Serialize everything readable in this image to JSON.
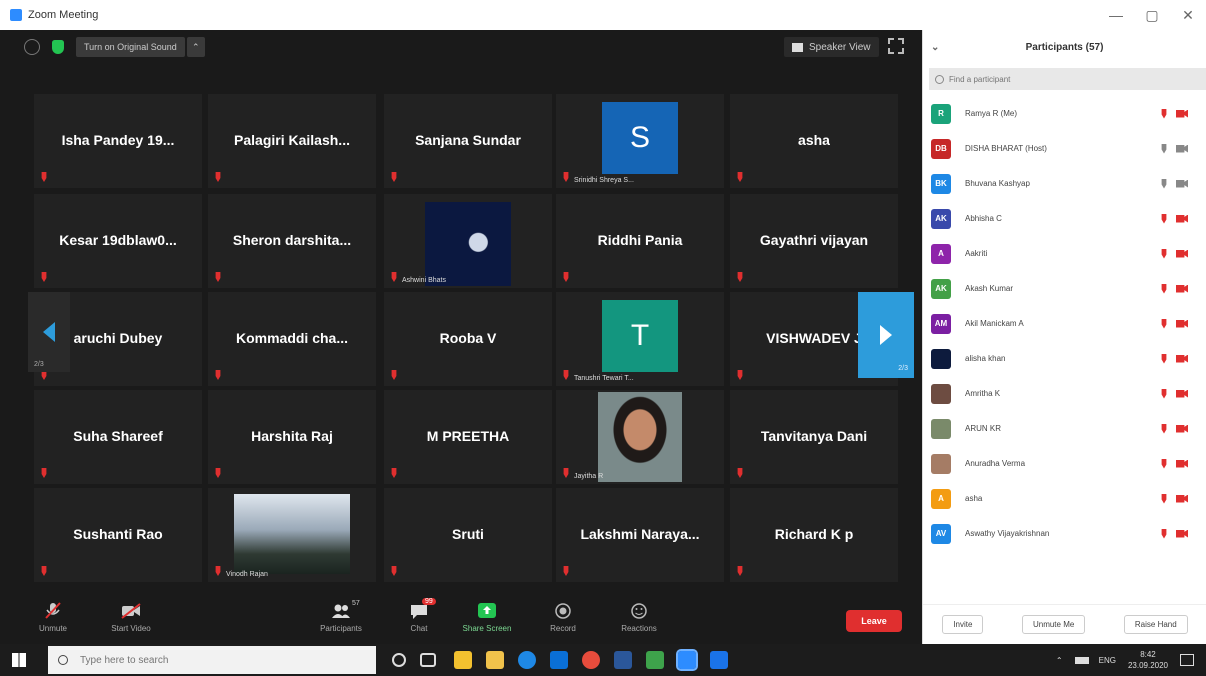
{
  "window": {
    "title": "Zoom Meeting",
    "controls": [
      "—",
      "▢",
      "✕"
    ]
  },
  "topbar": {
    "original_sound": "Turn on Original Sound",
    "caret": "⌃",
    "speaker_view": "Speaker View"
  },
  "pager": {
    "left_page": "2/3",
    "right_page": "2/3"
  },
  "tiles": [
    {
      "name": "Isha Pandey 19..."
    },
    {
      "name": "Palagiri Kailash..."
    },
    {
      "name": "Sanjana Sundar"
    },
    {
      "name": "",
      "avatar_letter": "S",
      "avatar_color": "#1565b5",
      "caption": "Srinidhi Shreya S..."
    },
    {
      "name": "asha"
    },
    {
      "name": "Kesar 19dblaw0..."
    },
    {
      "name": "Sheron darshita..."
    },
    {
      "name": "",
      "image": "moon",
      "caption": "Ashwini Bhats"
    },
    {
      "name": "Riddhi Pania"
    },
    {
      "name": "Gayathri vijayan"
    },
    {
      "name": "aruchi Dubey"
    },
    {
      "name": "Kommaddi cha..."
    },
    {
      "name": "Rooba V"
    },
    {
      "name": "",
      "avatar_letter": "T",
      "avatar_color": "#13967f",
      "caption": "Tanushri Tewari T..."
    },
    {
      "name": "VISHWADEV J"
    },
    {
      "name": "Suha Shareef"
    },
    {
      "name": "Harshita Raj"
    },
    {
      "name": "M PREETHA"
    },
    {
      "name": "",
      "image": "portrait",
      "caption": "Jayitha R"
    },
    {
      "name": "Tanvitanya Dani"
    },
    {
      "name": "Sushanti Rao"
    },
    {
      "name": "",
      "image": "landscape",
      "caption": "Vinodh Rajan"
    },
    {
      "name": "Sruti"
    },
    {
      "name": "Lakshmi Naraya..."
    },
    {
      "name": "Richard K p"
    }
  ],
  "toolbar": {
    "unmute": "Unmute",
    "start_video": "Start Video",
    "participants": "Participants",
    "participants_count": "57",
    "chat": "Chat",
    "chat_badge": "99",
    "share_screen": "Share Screen",
    "record": "Record",
    "reactions": "Reactions",
    "leave": "Leave"
  },
  "panel": {
    "title": "Participants (57)",
    "search_placeholder": "Find a participant",
    "participants": [
      {
        "name": "Ramya R (Me)",
        "initials": "R",
        "color": "#1aa37a",
        "mic": "muted",
        "cam": "off"
      },
      {
        "name": "DISHA BHARAT (Host)",
        "initials": "DB",
        "color": "#c62828",
        "mic": "on",
        "cam": "on"
      },
      {
        "name": "Bhuvana Kashyap",
        "initials": "BK",
        "color": "#1e88e5",
        "mic": "on",
        "cam": "on"
      },
      {
        "name": "Abhisha C",
        "initials": "AK",
        "color": "#3949ab",
        "mic": "muted",
        "cam": "off"
      },
      {
        "name": "Aakriti",
        "initials": "A",
        "color": "#8e24aa",
        "mic": "muted",
        "cam": "off"
      },
      {
        "name": "Akash Kumar",
        "initials": "AK",
        "color": "#43a047",
        "mic": "muted",
        "cam": "off"
      },
      {
        "name": "Akil Manickam A",
        "initials": "AM",
        "color": "#7b1fa2",
        "mic": "muted",
        "cam": "off"
      },
      {
        "name": "alisha khan",
        "initials": "",
        "color": "#0d1b3d",
        "mic": "muted",
        "cam": "off"
      },
      {
        "name": "Amritha K",
        "initials": "",
        "color": "#6d4c41",
        "mic": "muted",
        "cam": "off"
      },
      {
        "name": "ARUN KR",
        "initials": "",
        "color": "#7a8a6a",
        "mic": "muted",
        "cam": "off"
      },
      {
        "name": "Anuradha Verma",
        "initials": "",
        "color": "#a57c65",
        "mic": "muted",
        "cam": "off"
      },
      {
        "name": "asha",
        "initials": "A",
        "color": "#f39c12",
        "mic": "muted",
        "cam": "off"
      },
      {
        "name": "Aswathy Vijayakrishnan",
        "initials": "AV",
        "color": "#1e88e5",
        "mic": "muted",
        "cam": "off"
      }
    ],
    "footer": [
      "Invite",
      "Unmute Me",
      "Raise Hand"
    ]
  },
  "taskbar": {
    "search_placeholder": "Type here to search",
    "lang": "ENG",
    "time": "8:42",
    "date": "23.09.2020"
  }
}
